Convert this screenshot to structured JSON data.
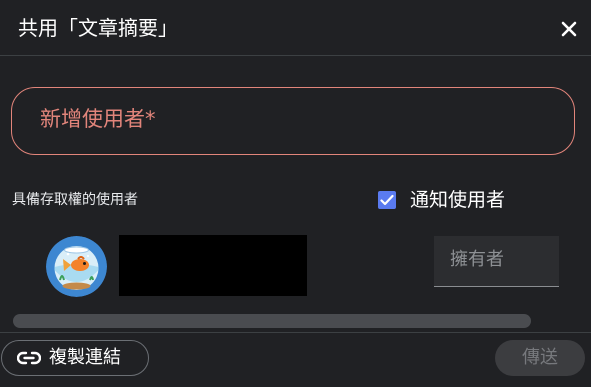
{
  "dialog": {
    "title": "共用「文章摘要」",
    "close_icon": "close-icon"
  },
  "add_user": {
    "label": "新增使用者*"
  },
  "access": {
    "label": "具備存取權的使用者"
  },
  "notify": {
    "label": "通知使用者",
    "checked": true
  },
  "user": {
    "avatar_icon": "goldfish-bowl-avatar",
    "role": "擁有者"
  },
  "footer": {
    "copy_link_label": "複製連結",
    "link_icon": "link-icon",
    "send_label": "傳送"
  },
  "colors": {
    "background": "#202124",
    "error_accent": "#e2857b",
    "checkbox": "#5a7bf0"
  }
}
